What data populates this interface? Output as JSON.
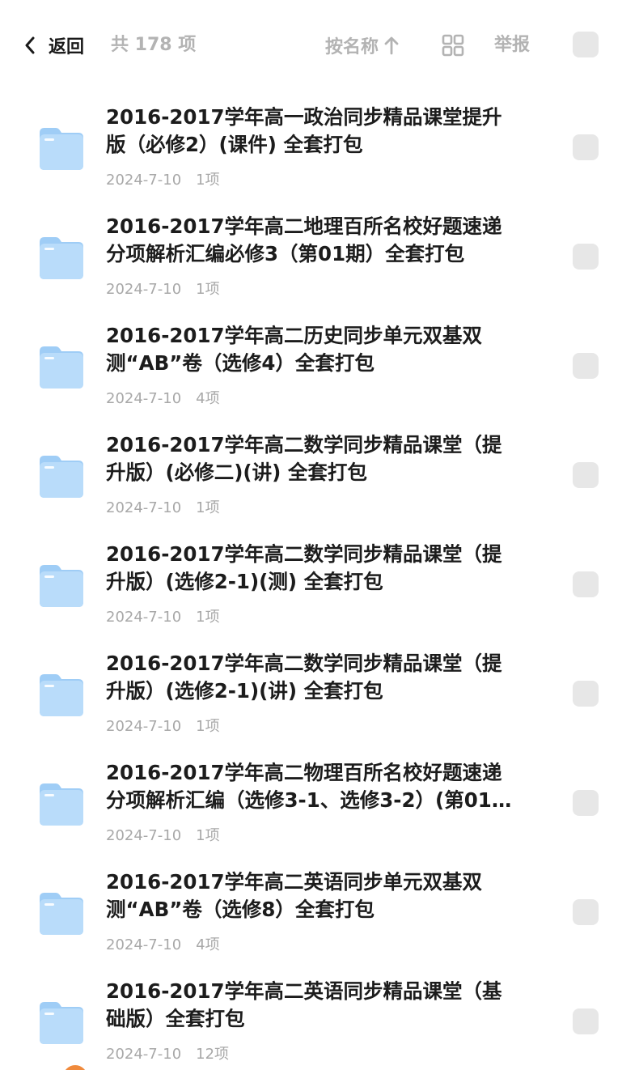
{
  "header": {
    "back_label": "返回",
    "count_text": "共 178 项",
    "sort_label": "按名称",
    "report_label": "举报"
  },
  "colors": {
    "folder_fill": "#9fcdf6",
    "folder_tab": "#b9dcfa",
    "muted_text": "#b3b3b3",
    "checkbox_fill": "#e7e7e7"
  },
  "icons": {
    "back": "chevron-left-icon",
    "sort": "arrow-up-icon",
    "view": "grid-view-icon",
    "folder": "folder-icon"
  },
  "items": [
    {
      "title_line1": "2016-2017学年高一政治同步精品课堂提升",
      "title_line2": "版（必修2）(课件) 全套打包",
      "date": "2024-7-10",
      "count": "1项"
    },
    {
      "title_line1": "2016-2017学年高二地理百所名校好题速递",
      "title_line2": "分项解析汇编必修3（第01期）全套打包",
      "date": "2024-7-10",
      "count": "1项"
    },
    {
      "title_line1": "2016-2017学年高二历史同步单元双基双",
      "title_line2": "测“AB”卷（选修4）全套打包",
      "date": "2024-7-10",
      "count": "4项"
    },
    {
      "title_line1": "2016-2017学年高二数学同步精品课堂（提",
      "title_line2": "升版）(必修二)(讲) 全套打包",
      "date": "2024-7-10",
      "count": "1项"
    },
    {
      "title_line1": "2016-2017学年高二数学同步精品课堂（提",
      "title_line2": "升版）(选修2-1)(测) 全套打包",
      "date": "2024-7-10",
      "count": "1项"
    },
    {
      "title_line1": "2016-2017学年高二数学同步精品课堂（提",
      "title_line2": "升版）(选修2-1)(讲) 全套打包",
      "date": "2024-7-10",
      "count": "1项"
    },
    {
      "title_line1": "2016-2017学年高二物理百所名校好题速递",
      "title_line2": "分项解析汇编（选修3-1、选修3-2）(第01…",
      "date": "2024-7-10",
      "count": "1项"
    },
    {
      "title_line1": "2016-2017学年高二英语同步单元双基双",
      "title_line2": "测“AB”卷（选修8）全套打包",
      "date": "2024-7-10",
      "count": "4项"
    },
    {
      "title_line1": "2016-2017学年高二英语同步精品课堂（基",
      "title_line2": "础版）全套打包",
      "date": "2024-7-10",
      "count": "12项"
    }
  ]
}
